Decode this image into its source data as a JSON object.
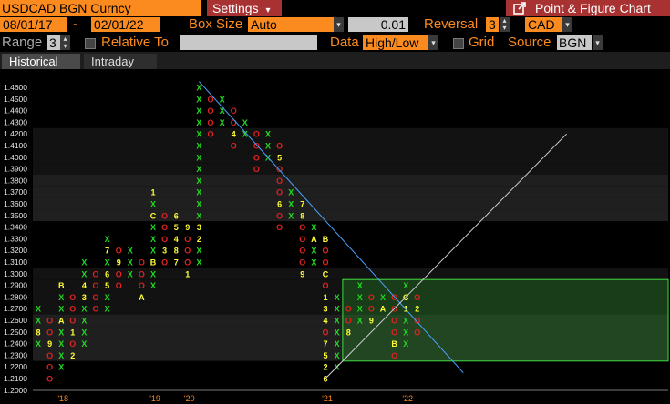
{
  "header": {
    "ticker": "USDCAD BGN Curncy",
    "settings_label": "Settings",
    "settings_caret": "▾",
    "chart_title": "Point & Figure Chart",
    "export_icon": "external-link-icon"
  },
  "controls": {
    "start_date": "08/01/17",
    "date_sep": "-",
    "end_date": "02/01/22",
    "box_size_label": "Box Size",
    "box_size_mode": "Auto",
    "box_size_value": "0.01",
    "reversal_label": "Reversal",
    "reversal_value": "3",
    "currency": "CAD",
    "range_label": "Range",
    "range_value": "3",
    "relative_to_label": "Relative To",
    "relative_to_value": "",
    "data_label": "Data",
    "data_value": "High/Low",
    "grid_label": "Grid",
    "source_label": "Source",
    "source_value": "BGN"
  },
  "tabs": [
    {
      "label": "Historical"
    },
    {
      "label": "Intraday"
    }
  ],
  "colors": {
    "accent": "#fb8b1e",
    "x_mark": "#22dd22",
    "o_mark": "#dd2222",
    "month_mark": "#ffff33",
    "trend": "#4aa3ff",
    "box": "#3fdd3f"
  },
  "chart_data": {
    "type": "point-and-figure",
    "box_size": 0.01,
    "reversal": 3,
    "ylim": [
      1.2,
      1.46
    ],
    "y_ticks": [
      "1.4600",
      "1.4500",
      "1.4400",
      "1.4300",
      "1.4200",
      "1.4100",
      "1.4000",
      "1.3900",
      "1.3800",
      "1.3700",
      "1.3600",
      "1.3500",
      "1.3400",
      "1.3300",
      "1.3200",
      "1.3100",
      "1.3000",
      "1.2900",
      "1.2800",
      "1.2700",
      "1.2600",
      "1.2500",
      "1.2400",
      "1.2300",
      "1.2200",
      "1.2100",
      "1.2000"
    ],
    "x_labels": [
      {
        "text": "'18",
        "col": 2
      },
      {
        "text": "'19",
        "col": 10
      },
      {
        "text": "'20",
        "col": 13
      },
      {
        "text": "'21",
        "col": 25
      },
      {
        "text": "'22",
        "col": 32
      }
    ],
    "columns": [
      {
        "t": "X",
        "lo": 1.24,
        "hi": 1.27,
        "m": {
          "1.25": "8"
        }
      },
      {
        "t": "O",
        "lo": 1.21,
        "hi": 1.26,
        "m": {
          "1.24": "9"
        }
      },
      {
        "t": "X",
        "lo": 1.22,
        "hi": 1.29,
        "m": {
          "1.29": "B",
          "1.26": "A"
        }
      },
      {
        "t": "O",
        "lo": 1.23,
        "hi": 1.28,
        "m": {
          "1.23": "2",
          "1.25": "1"
        }
      },
      {
        "t": "X",
        "lo": 1.24,
        "hi": 1.31,
        "m": {
          "1.29": "4",
          "1.28": "3"
        }
      },
      {
        "t": "O",
        "lo": 1.27,
        "hi": 1.3
      },
      {
        "t": "X",
        "lo": 1.27,
        "hi": 1.33,
        "m": {
          "1.32": "7",
          "1.30": "6",
          "1.29": "5"
        }
      },
      {
        "t": "O",
        "lo": 1.29,
        "hi": 1.32,
        "m": {
          "1.31": "9"
        }
      },
      {
        "t": "X",
        "lo": 1.3,
        "hi": 1.32
      },
      {
        "t": "O",
        "lo": 1.28,
        "hi": 1.31,
        "m": {
          "1.28": "A"
        }
      },
      {
        "t": "X",
        "lo": 1.29,
        "hi": 1.37,
        "m": {
          "1.37": "1",
          "1.35": "C",
          "1.31": "B"
        }
      },
      {
        "t": "O",
        "lo": 1.31,
        "hi": 1.35,
        "m": {
          "1.32": "3"
        }
      },
      {
        "t": "X",
        "lo": 1.31,
        "hi": 1.35,
        "m": {
          "1.35": "6",
          "1.34": "5",
          "1.33": "4",
          "1.32": "8",
          "1.31": "7"
        }
      },
      {
        "t": "O",
        "lo": 1.3,
        "hi": 1.34,
        "m": {
          "1.34": "9",
          "1.30": "1"
        }
      },
      {
        "t": "X",
        "lo": 1.31,
        "hi": 1.46,
        "m": {
          "1.34": "3",
          "1.33": "2"
        }
      },
      {
        "t": "O",
        "lo": 1.42,
        "hi": 1.45
      },
      {
        "t": "X",
        "lo": 1.43,
        "hi": 1.45
      },
      {
        "t": "O",
        "lo": 1.41,
        "hi": 1.44,
        "m": {
          "1.42": "4"
        }
      },
      {
        "t": "X",
        "lo": 1.42,
        "hi": 1.43
      },
      {
        "t": "O",
        "lo": 1.39,
        "hi": 1.42
      },
      {
        "t": "X",
        "lo": 1.4,
        "hi": 1.42
      },
      {
        "t": "O",
        "lo": 1.34,
        "hi": 1.41,
        "m": {
          "1.40": "5",
          "1.36": "6"
        }
      },
      {
        "t": "X",
        "lo": 1.35,
        "hi": 1.37
      },
      {
        "t": "O",
        "lo": 1.3,
        "hi": 1.36,
        "m": {
          "1.36": "7",
          "1.35": "8",
          "1.30": "9"
        }
      },
      {
        "t": "X",
        "lo": 1.31,
        "hi": 1.34,
        "m": {
          "1.33": "A"
        }
      },
      {
        "t": "O",
        "lo": 1.21,
        "hi": 1.33,
        "m": {
          "1.33": "B",
          "1.30": "C",
          "1.28": "1",
          "1.27": "3",
          "1.26": "4",
          "1.24": "7",
          "1.23": "5",
          "1.22": "2",
          "1.21": "6"
        }
      },
      {
        "t": "X",
        "lo": 1.22,
        "hi": 1.28
      },
      {
        "t": "O",
        "lo": 1.25,
        "hi": 1.27,
        "m": {
          "1.25": "8"
        }
      },
      {
        "t": "X",
        "lo": 1.26,
        "hi": 1.29
      },
      {
        "t": "O",
        "lo": 1.26,
        "hi": 1.28,
        "m": {
          "1.26": "9"
        }
      },
      {
        "t": "X",
        "lo": 1.27,
        "hi": 1.28,
        "m": {
          "1.27": "A"
        }
      },
      {
        "t": "O",
        "lo": 1.23,
        "hi": 1.28,
        "m": {
          "1.24": "B"
        }
      },
      {
        "t": "X",
        "lo": 1.24,
        "hi": 1.29,
        "m": {
          "1.28": "C",
          "1.27": "1"
        }
      },
      {
        "t": "O",
        "lo": 1.25,
        "hi": 1.28,
        "m": {
          "1.27": "2"
        }
      }
    ],
    "trendlines": [
      {
        "kind": "down",
        "from": {
          "col": 14,
          "y": 1.465
        },
        "to": {
          "col": 37,
          "y": 1.215
        }
      },
      {
        "kind": "up",
        "from": {
          "col": 25,
          "y": 1.21
        },
        "to": {
          "col": 46,
          "y": 1.42
        }
      }
    ],
    "box": {
      "col_from": 26.5,
      "y_from": 1.225,
      "y_to": 1.295
    }
  }
}
